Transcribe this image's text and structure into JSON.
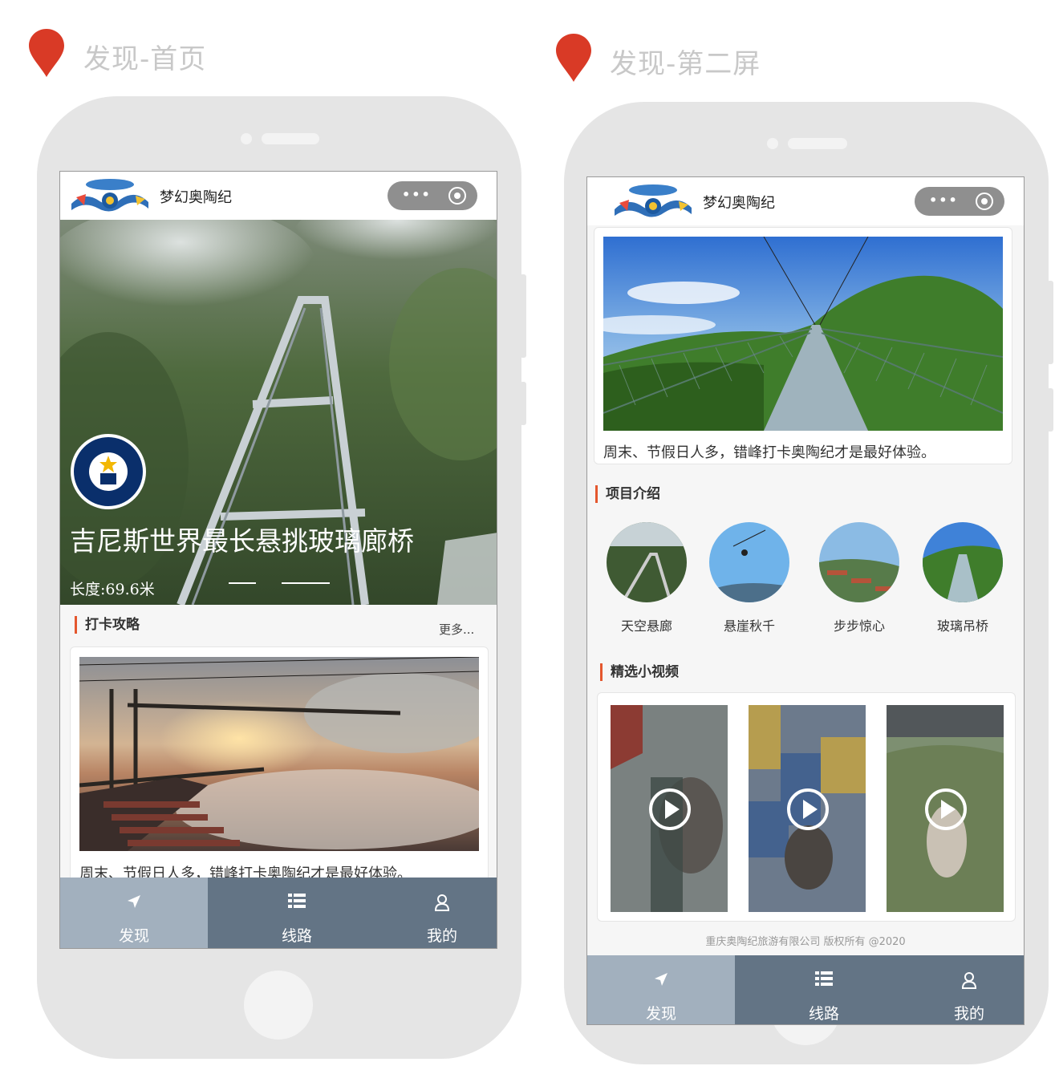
{
  "left": {
    "label": "发现-首页",
    "app_title": "梦幻奥陶纪",
    "capsule_dots": "•••",
    "hero": {
      "title": "吉尼斯世界最长悬挑玻璃廊桥",
      "length": "长度:69.6米",
      "badge": "GUINNESS WORLD RECORDS"
    },
    "section_title": "打卡攻略",
    "more_label": "更多...",
    "card_caption": "周末、节假日人多，错峰打卡奥陶纪才是最好体验。",
    "tabs": [
      {
        "label": "发现",
        "icon": "location-arrow-icon"
      },
      {
        "label": "线路",
        "icon": "list-icon"
      },
      {
        "label": "我的",
        "icon": "user-icon"
      }
    ]
  },
  "right": {
    "label": "发现-第二屏",
    "app_title": "梦幻奥陶纪",
    "capsule_dots": "•••",
    "card_caption": "周末、节假日人多，错峰打卡奥陶纪才是最好体验。",
    "projects_title": "项目介绍",
    "projects": [
      {
        "label": "天空悬廊"
      },
      {
        "label": "悬崖秋千"
      },
      {
        "label": "步步惊心"
      },
      {
        "label": "玻璃吊桥"
      }
    ],
    "videos_title": "精选小视频",
    "videos": [
      {
        "name": "video-1"
      },
      {
        "name": "video-2"
      },
      {
        "name": "video-3"
      }
    ],
    "copyright": "重庆奥陶纪旅游有限公司  版权所有    @2020",
    "tabs": [
      {
        "label": "发现",
        "icon": "location-arrow-icon"
      },
      {
        "label": "线路",
        "icon": "list-icon"
      },
      {
        "label": "我的",
        "icon": "user-icon"
      }
    ]
  },
  "colors": {
    "pin": "#d93a26",
    "tabbar": "#637485",
    "tab_active": "#a2b0be",
    "accent_bar": "#e4572e"
  }
}
